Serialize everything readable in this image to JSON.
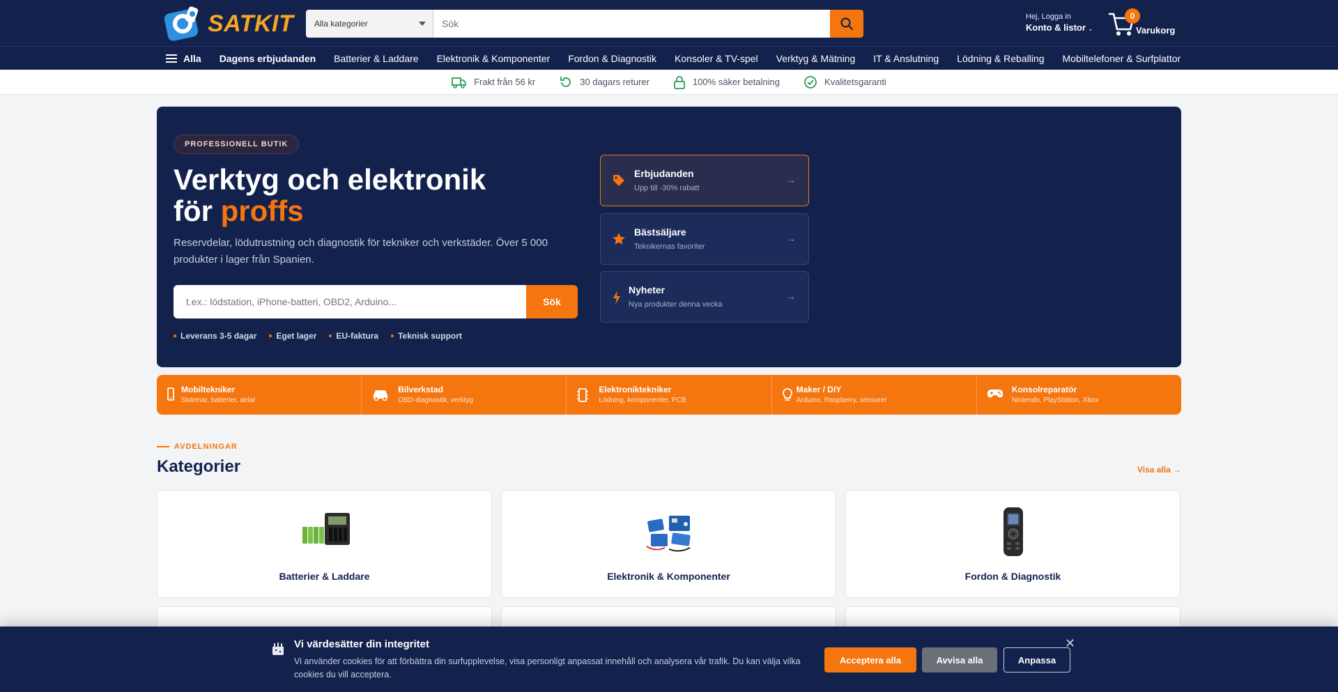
{
  "header": {
    "logo_text": "SATKIT",
    "category_select": "Alla kategorier",
    "search_placeholder": "Sök",
    "account_greeting": "Hej, Logga in",
    "account_label": "Konto & listor",
    "cart_count": "0",
    "cart_label": "Varukorg"
  },
  "nav": {
    "all_label": "Alla",
    "items": [
      "Dagens erbjudanden",
      "Batterier & Laddare",
      "Elektronik & Komponenter",
      "Fordon & Diagnostik",
      "Konsoler & TV-spel",
      "Verktyg & Mätning",
      "IT & Anslutning",
      "Lödning & Reballing",
      "Mobiltelefoner & Surfplattor"
    ]
  },
  "trust": [
    {
      "label": "Frakt från 56 kr",
      "icon": "truck-icon"
    },
    {
      "label": "30 dagars returer",
      "icon": "return-icon"
    },
    {
      "label": "100% säker betalning",
      "icon": "lock-icon"
    },
    {
      "label": "Kvalitetsgaranti",
      "icon": "check-circle-icon"
    }
  ],
  "hero": {
    "pill": "PROFESSIONELL BUTIK",
    "title_line1": "Verktyg och elektronik",
    "title_line2_prefix": "för ",
    "title_line2_accent": "proffs",
    "description": "Reservdelar, lödutrustning och diagnostik för tekniker och verkstäder. Över 5 000 produkter i lager från Spanien.",
    "search_placeholder": "t.ex.: lödstation, iPhone-batteri, OBD2, Arduino...",
    "search_button": "Sök",
    "bullets": [
      "Leverans 3-5 dagar",
      "Eget lager",
      "EU-faktura",
      "Teknisk support"
    ],
    "promos": [
      {
        "title": "Erbjudanden",
        "subtitle": "Upp till -30% rabatt",
        "icon": "tag-icon",
        "arrow": "→"
      },
      {
        "title": "Bästsäljare",
        "subtitle": "Teknikernas favoriter",
        "icon": "star-icon",
        "arrow": "→"
      },
      {
        "title": "Nyheter",
        "subtitle": "Nya produkter denna vecka",
        "icon": "bolt-icon",
        "arrow": "→"
      }
    ]
  },
  "segments": [
    {
      "title": "Mobiltekniker",
      "subtitle": "Skärmar, batterier, delar",
      "icon": "phone-icon"
    },
    {
      "title": "Bilverkstad",
      "subtitle": "OBD-diagnostik, verktyg",
      "icon": "car-icon"
    },
    {
      "title": "Elektroniktekniker",
      "subtitle": "Lödning, komponenter, PCB",
      "icon": "chip-icon"
    },
    {
      "title": "Maker / DIY",
      "subtitle": "Arduino, Raspberry, sensorer",
      "icon": "bulb-icon"
    },
    {
      "title": "Konsolreparatör",
      "subtitle": "Nintendo, PlayStation, Xbox",
      "icon": "gamepad-icon"
    }
  ],
  "categories": {
    "eyebrow": "AVDELNINGAR",
    "title": "Kategorier",
    "see_all": "Visa alla →",
    "items": [
      {
        "label": "Batterier & Laddare",
        "icon": "battery-charger-icon"
      },
      {
        "label": "Elektronik & Komponenter",
        "icon": "electronics-kit-icon"
      },
      {
        "label": "Fordon & Diagnostik",
        "icon": "obd-scanner-icon"
      }
    ]
  },
  "cookie": {
    "title": "Vi värdesätter din integritet",
    "text": "Vi använder cookies för att förbättra din surfupplevelse, visa personligt anpassat innehåll och analysera vår trafik. Du kan välja vilka cookies du vill acceptera.",
    "accept": "Acceptera alla",
    "reject": "Avvisa alla",
    "customize": "Anpassa",
    "close": "✕"
  },
  "colors": {
    "navy": "#13224d",
    "orange": "#f5750f"
  }
}
